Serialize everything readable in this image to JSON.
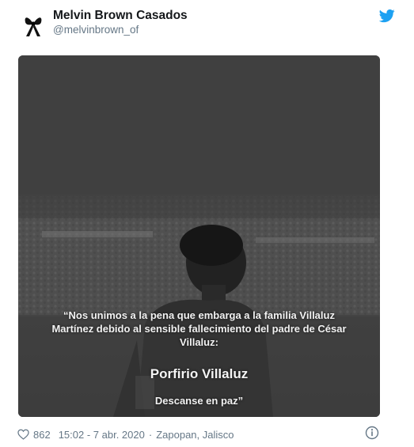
{
  "author": {
    "name": "Melvin Brown Casados",
    "handle": "@melvinbrown_of",
    "avatar_icon": "black-ribbon-icon"
  },
  "media": {
    "quote": "“Nos unimos a la pena que embarga a la familia Villaluz Martínez debido al sensible fallecimiento del padre de César Villaluz:",
    "person_name": "Porfirio Villaluz",
    "closing": "Descanse en paz”"
  },
  "footer": {
    "likes": "862",
    "time_date": "15:02 - 7 abr. 2020",
    "separator": "·",
    "location": "Zapopan, Jalisco"
  },
  "colors": {
    "brand": "#1da1f2",
    "muted": "#657786",
    "text": "#14171a"
  }
}
